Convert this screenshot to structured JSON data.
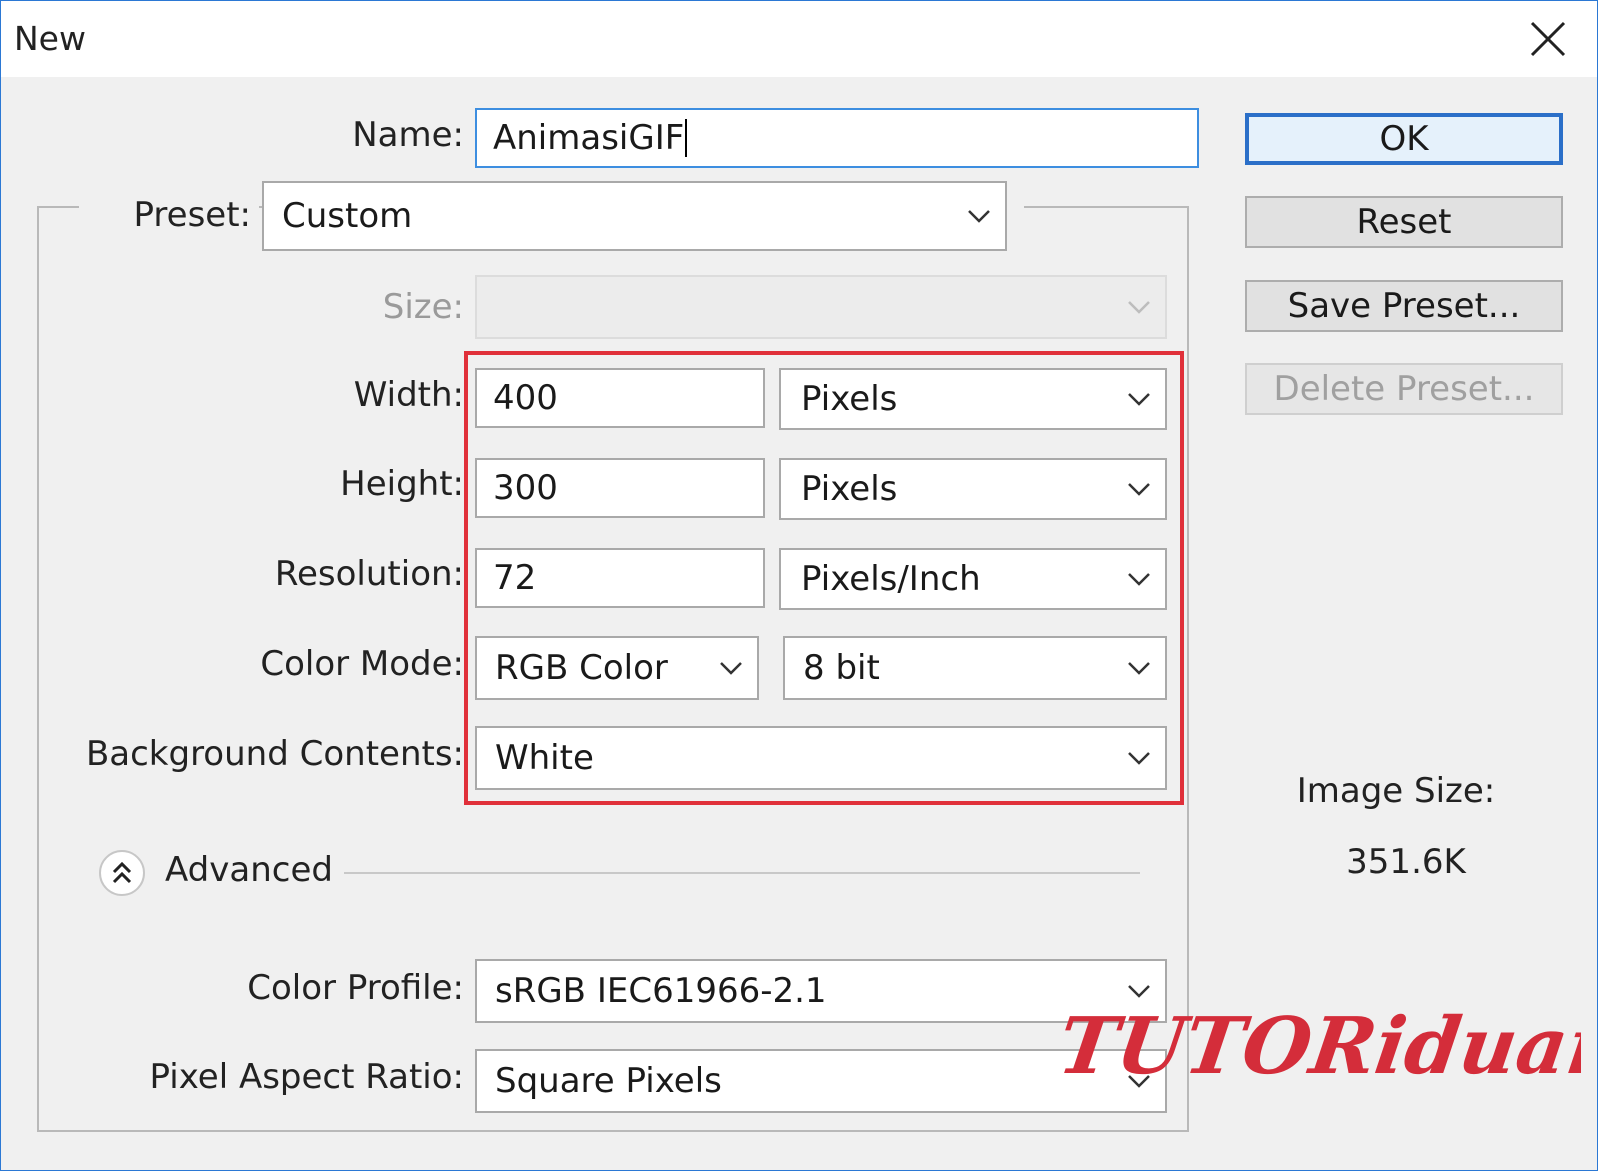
{
  "window": {
    "title": "New"
  },
  "form": {
    "name": {
      "label": "Name:",
      "value": "AnimasiGIF"
    },
    "preset": {
      "label": "Preset:",
      "value": "Custom"
    },
    "size": {
      "label": "Size:",
      "value": ""
    },
    "width": {
      "label": "Width:",
      "value": "400",
      "unit": "Pixels"
    },
    "height": {
      "label": "Height:",
      "value": "300",
      "unit": "Pixels"
    },
    "resolution": {
      "label": "Resolution:",
      "value": "72",
      "unit": "Pixels/Inch"
    },
    "color_mode": {
      "label": "Color Mode:",
      "value": "RGB Color",
      "bit_depth": "8 bit"
    },
    "background": {
      "label": "Background Contents:",
      "value": "White"
    },
    "advanced": {
      "label": "Advanced"
    },
    "color_profile": {
      "label": "Color Profile:",
      "value": "sRGB IEC61966-2.1"
    },
    "pixel_aspect": {
      "label": "Pixel Aspect Ratio:",
      "value": "Square Pixels"
    }
  },
  "buttons": {
    "ok": "OK",
    "reset": "Reset",
    "save_preset": "Save Preset...",
    "delete_preset": "Delete Preset..."
  },
  "image_size": {
    "label": "Image Size:",
    "value": "351.6K"
  },
  "watermark": {
    "text": "TUTORiduan"
  },
  "colors": {
    "highlight": "#e0303a",
    "focus": "#3d8ee0",
    "watermark": "#d42d3a"
  }
}
